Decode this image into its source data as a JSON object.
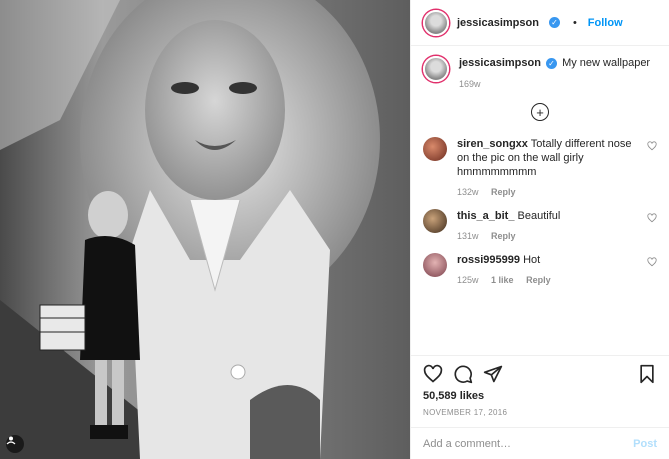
{
  "post": {
    "username": "jessicasimpson",
    "follow_label": "Follow",
    "dot": "•",
    "caption": "My new wallpaper",
    "caption_age": "169w",
    "likes": "50,589 likes",
    "date": "NOVEMBER 17, 2016",
    "comment_placeholder": "Add a comment…",
    "post_label": "Post"
  },
  "comments": [
    {
      "username": "siren_songxx",
      "text": "Totally different nose on the pic on the wall girly hmmmmmmmm",
      "age": "132w",
      "likes": "",
      "reply": "Reply"
    },
    {
      "username": "this_a_bit_",
      "text": "Beautiful",
      "age": "131w",
      "likes": "",
      "reply": "Reply"
    },
    {
      "username": "rossi995999",
      "text": "Hot",
      "age": "125w",
      "likes": "1 like",
      "reply": "Reply"
    }
  ],
  "icons": [
    "heart-icon",
    "comment-icon",
    "share-icon",
    "bookmark-icon",
    "load-more-icon",
    "verified-icon"
  ],
  "colors": {
    "accent": "#0095f6",
    "verified": "#3897f0",
    "muted": "#8e8e8e"
  }
}
